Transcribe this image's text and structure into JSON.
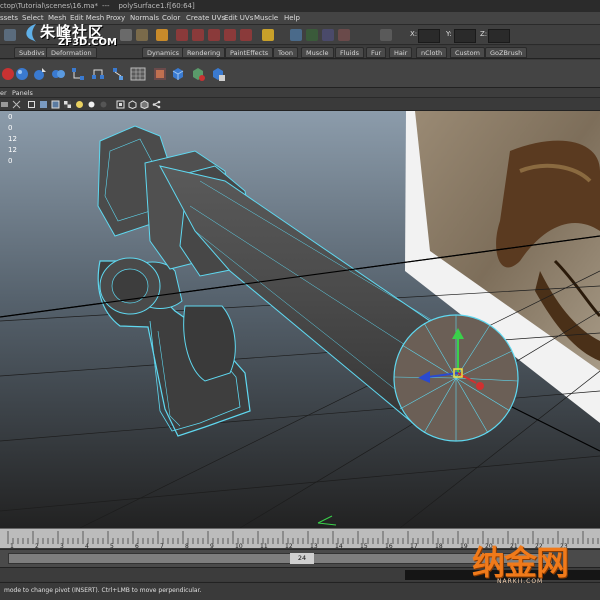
{
  "window": {
    "title_path": "ctop\\Tutorial\\scenes\\16.ma*",
    "title_sep": "---",
    "title_object": "polySurface1.f[60:64]"
  },
  "menubar": {
    "items": [
      "ssets",
      "Select",
      "Mesh",
      "Edit Mesh",
      "Proxy",
      "Normals",
      "Color",
      "Create UVs",
      "Edit UVs",
      "Muscle",
      "Help"
    ]
  },
  "statusline": {
    "x_label": "X:",
    "y_label": "Y:",
    "z_label": "Z:"
  },
  "logo": {
    "cn": "朱峰社区",
    "en": "ZF3D.COM"
  },
  "shelf": {
    "tabs": [
      "Subdivs",
      "Deformation",
      "Dynamics",
      "Rendering",
      "PaintEffects",
      "Toon",
      "Muscle",
      "Fluids",
      "Fur",
      "Hair",
      "nCloth",
      "Custom",
      "GoZBrush"
    ]
  },
  "panel_menu": {
    "items": [
      "er",
      "Panels"
    ]
  },
  "hud": {
    "lines": [
      "0",
      "0",
      "12",
      "12",
      "0"
    ]
  },
  "timeline": {
    "ticks": [
      "1",
      "2",
      "3",
      "4",
      "5",
      "6",
      "7",
      "8",
      "9",
      "10",
      "11",
      "12",
      "13",
      "14",
      "15",
      "16",
      "17",
      "18",
      "19",
      "20",
      "21",
      "22",
      "23"
    ],
    "current_frame": "24"
  },
  "helpline": {
    "message": "mode to change pivot (INSERT).  Ctrl+LMB to move perpendicular."
  },
  "watermark": {
    "cn": "纳金网",
    "en": "NARKII.COM"
  },
  "colors": {
    "wireframe": "#5fd8f0",
    "mesh_face": "#4a4a4a",
    "viewport_top": "#8a9aa8",
    "viewport_bottom": "#242424",
    "watermark": "#f07a1a"
  }
}
